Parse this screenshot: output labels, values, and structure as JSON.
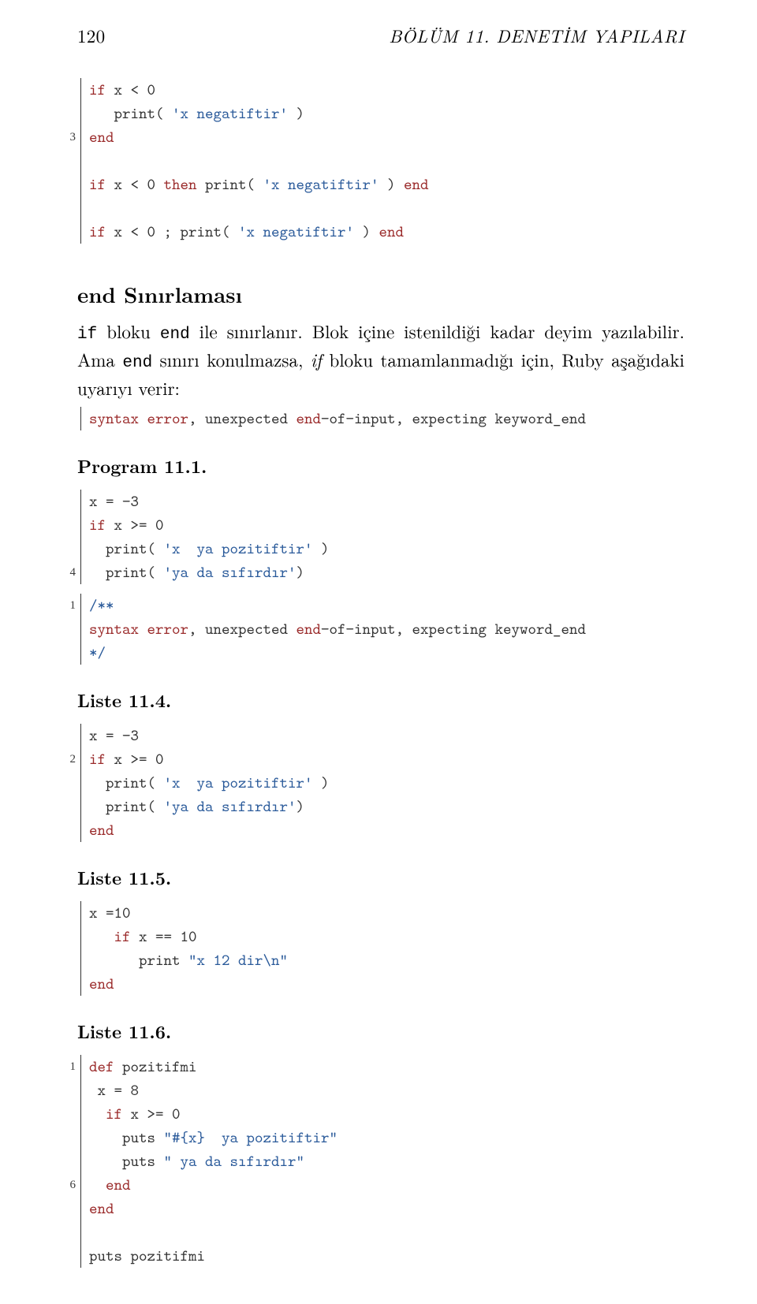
{
  "header": {
    "page": "120",
    "chapter": "BÖLÜM 11.  DENETİM YAPILARI"
  },
  "code1": {
    "gutter": [
      "",
      "",
      "3",
      "",
      "",
      "",
      ""
    ],
    "l1a": "if",
    "l1b": " x < 0",
    "l2": "   print( ",
    "l2s": "'x negatiftir'",
    "l2c": " )",
    "l3": "end",
    "l5a": "if",
    "l5b": " x < 0 ",
    "l5c": "then",
    "l5d": " print( ",
    "l5s": "'x negatiftir'",
    "l5e": " ) ",
    "l5f": "end",
    "l7a": "if",
    "l7b": " x < 0 ; print( ",
    "l7s": "'x negatiftir'",
    "l7c": " ) ",
    "l7d": "end"
  },
  "sec_end": "end Sınırlaması",
  "para1a": "if",
  "para1b": " bloku ",
  "para1c": "end",
  "para1d": " ile sınırlanır. Blok içine istenildiği kadar deyim yazılabilir. Ama ",
  "para1e": "end",
  "para1f": " sınırı konulmazsa, ",
  "para1g": "if",
  "para1h": " bloku tamamlanmadığı için, Ruby aşağıdaki uyarıyı verir:",
  "err1a": "syntax error",
  "err1b": ", unexpected ",
  "err1c": "end",
  "err1d": "−of−input, expecting keyword_end",
  "h_prog": "Program 11.1.",
  "code2": {
    "gutter": [
      "",
      "",
      "",
      "4"
    ],
    "l1": "x = −3",
    "l2a": "if",
    "l2b": " x >= 0",
    "l3a": "  print( ",
    "l3s": "'x  ya pozitiftir'",
    "l3b": " )",
    "l4a": "  print( ",
    "l4s": "'ya da sıfırdır'",
    "l4b": ")"
  },
  "code3": {
    "gutter": [
      "1",
      "",
      ""
    ],
    "l1": "/∗∗",
    "l2a": "syntax error",
    "l2b": ", unexpected ",
    "l2c": "end",
    "l2d": "−of−input, expecting keyword_end",
    "l3": "∗/"
  },
  "h_l4": "Liste 11.4.",
  "code4": {
    "gutter": [
      "",
      "2",
      "",
      "",
      ""
    ],
    "l1": "x = −3",
    "l2a": "if",
    "l2b": " x >= 0",
    "l3a": "  print( ",
    "l3s": "'x  ya pozitiftir'",
    "l3b": " )",
    "l4a": "  print( ",
    "l4s": "'ya da sıfırdır'",
    "l4b": ")",
    "l5": "end"
  },
  "h_l5": "Liste 11.5.",
  "code5": {
    "l1": "x =10",
    "l2a": "   if",
    "l2b": " x == 10",
    "l3a": "      print ",
    "l3s": "\"x 12 dir\\n\"",
    "l4": "end"
  },
  "h_l6": "Liste 11.6.",
  "code6": {
    "gutter": [
      "1",
      "",
      "",
      "",
      "",
      "6",
      "",
      "",
      ""
    ],
    "l1a": "def",
    "l1b": " pozitifmi",
    "l2": " x = 8",
    "l3a": "  if",
    "l3b": " x >= 0",
    "l4a": "    puts ",
    "l4s": "\"#{x}  ya pozitiftir\"",
    "l5a": "    puts ",
    "l5s": "\" ya da sıfırdır\"",
    "l6": "  end",
    "l7": "end",
    "l9": "puts pozitifmi"
  }
}
